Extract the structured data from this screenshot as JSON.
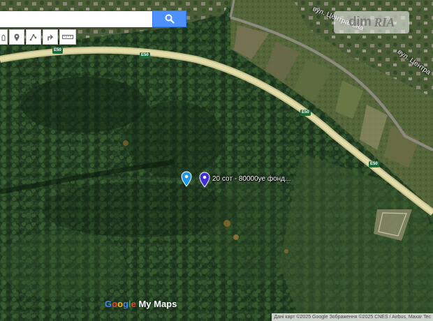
{
  "search": {
    "placeholder": ""
  },
  "toolbar": {
    "icons": [
      "hand-icon",
      "marker-icon",
      "line-icon",
      "directions-icon",
      "ruler-icon"
    ]
  },
  "watermark": {
    "left": "dim",
    "right": "RIA"
  },
  "map": {
    "type": "satellite",
    "street_labels": [
      "вул. Центральна",
      "вул. Центра"
    ],
    "highway_shields": [
      "E50",
      "E50",
      "E50",
      "E50"
    ],
    "pin_label": "20 сот - 80000уе фонд...",
    "pin_colors": [
      "#2196e8",
      "#3f2fd3"
    ],
    "logo": {
      "parts": [
        "G",
        "o",
        "o",
        "g",
        "l",
        "e",
        " My Maps"
      ],
      "colors": [
        "#4285f4",
        "#ea4335",
        "#fbbc05",
        "#4285f4",
        "#34a853",
        "#ea4335",
        "#ffffff"
      ]
    },
    "attribution": "Дані карт ©2025 Google Зображення ©2025 CNES / Airbus, Maxar Tec"
  }
}
